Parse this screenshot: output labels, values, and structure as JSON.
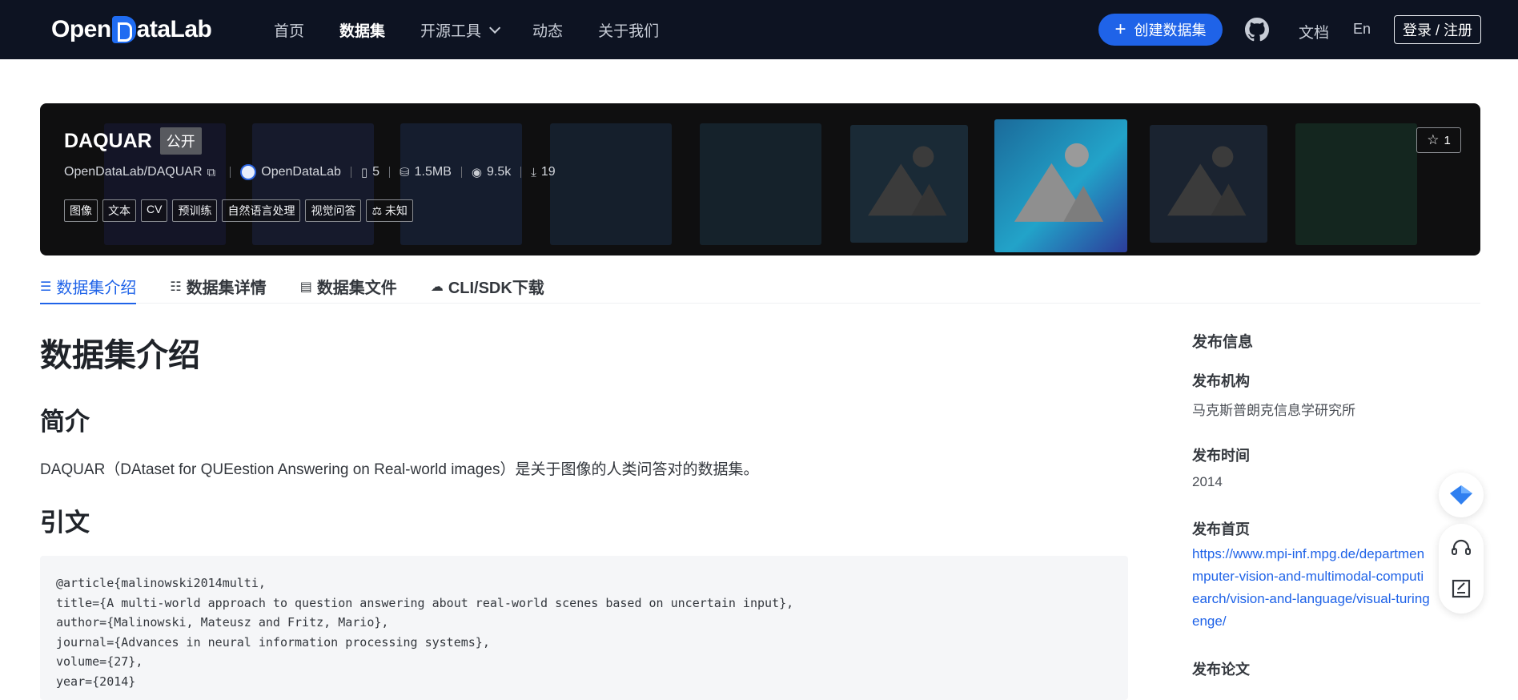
{
  "nav": {
    "logo_pre": "Open",
    "logo_d": "D",
    "logo_post": "ataLab",
    "links": [
      "首页",
      "数据集",
      "开源工具",
      "动态",
      "关于我们"
    ],
    "create_label": "创建数据集",
    "docs": "文档",
    "lang": "En",
    "login": "登录 / 注册"
  },
  "hero": {
    "name": "DAQUAR",
    "visibility": "公开",
    "path": "OpenDataLab/DAQUAR",
    "org": "OpenDataLab",
    "files": "5",
    "size": "1.5MB",
    "views": "9.5k",
    "downloads": "19",
    "tags": [
      "图像",
      "文本",
      "CV",
      "预训练",
      "自然语言处理",
      "视觉问答"
    ],
    "license": "未知",
    "stars": "1"
  },
  "tabs": [
    "数据集介绍",
    "数据集详情",
    "数据集文件",
    "CLI/SDK下载"
  ],
  "content": {
    "title": "数据集介绍",
    "intro_heading": "简介",
    "intro_text": "DAQUAR（DAtaset for QUEestion Answering on Real-world images）是关于图像的人类问答对的数据集。",
    "citation_heading": "引文",
    "citation": "@article{malinowski2014multi,\ntitle={A multi-world approach to question answering about real-world scenes based on uncertain input},\nauthor={Malinowski, Mateusz and Fritz, Mario},\njournal={Advances in neural information processing systems},\nvolume={27},\nyear={2014}"
  },
  "sidebar": {
    "heading": "发布信息",
    "org_label": "发布机构",
    "org_value": "马克斯普朗克信息学研究所",
    "time_label": "发布时间",
    "time_value": "2014",
    "home_label": "发布首页",
    "home_value": "https://www.mpi-inf.mpg.de/departmen\nmputer-vision-and-multimodal-computi\nearch/vision-and-language/visual-turing\nenge/",
    "paper_label": "发布论文"
  },
  "icons": {
    "star": "star-icon",
    "github": "github-icon",
    "support": "headset-icon",
    "feedback": "edit-icon",
    "assistant": "diamond-icon"
  },
  "colors": {
    "accent": "#1f63e8",
    "nav_bg": "#0d1322"
  }
}
